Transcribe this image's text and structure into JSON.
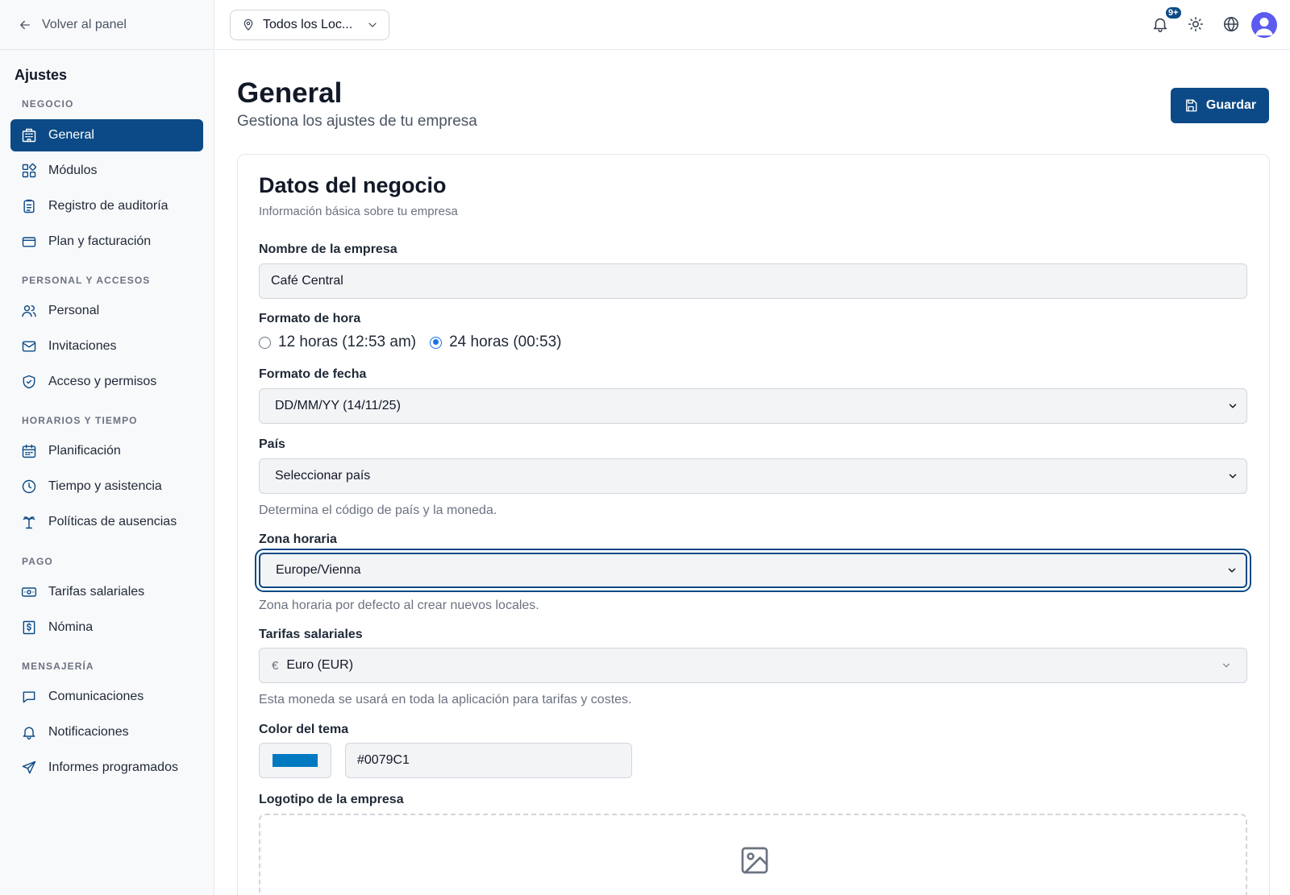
{
  "sidebar": {
    "back_label": "Volver al panel",
    "title": "Ajustes",
    "sections": {
      "negocio": "NEGOCIO",
      "personal": "PERSONAL Y ACCESOS",
      "horarios": "HORARIOS Y TIEMPO",
      "pago": "PAGO",
      "mensajeria": "MENSAJERÍA"
    },
    "items": {
      "general": "General",
      "modulos": "Módulos",
      "auditoria": "Registro de auditoría",
      "plan": "Plan y facturación",
      "personal": "Personal",
      "invitaciones": "Invitaciones",
      "acceso": "Acceso y permisos",
      "planificacion": "Planificación",
      "tiempo": "Tiempo y asistencia",
      "ausencias": "Políticas de ausencias",
      "tarifas": "Tarifas salariales",
      "nomina": "Nómina",
      "comunicaciones": "Comunicaciones",
      "notificaciones": "Notificaciones",
      "informes": "Informes programados"
    },
    "active_item": "general"
  },
  "topbar": {
    "location_label": "Todos los Loc...",
    "notification_badge": "9+",
    "icons": [
      "bell-icon",
      "sun-icon",
      "globe-icon",
      "avatar"
    ]
  },
  "page": {
    "title": "General",
    "subtitle": "Gestiona los ajustes de tu empresa",
    "save_label": "Guardar"
  },
  "card": {
    "title": "Datos del negocio",
    "subtitle": "Información básica sobre tu empresa",
    "company_name": {
      "label": "Nombre de la empresa",
      "value": "Café Central"
    },
    "time_format": {
      "label": "Formato de hora",
      "options": [
        "12 horas (12:53 am)",
        "24 horas (00:53)"
      ],
      "selected": "24 horas (00:53)"
    },
    "date_format": {
      "label": "Formato de fecha",
      "value": "DD/MM/YY (14/11/25)"
    },
    "country": {
      "label": "País",
      "value": "Seleccionar país",
      "helper": "Determina el código de país y la moneda."
    },
    "timezone": {
      "label": "Zona horaria",
      "value": "Europe/Vienna",
      "helper": "Zona horaria por defecto al crear nuevos locales."
    },
    "currency": {
      "label": "Tarifas salariales",
      "symbol": "€",
      "value": "Euro (EUR)",
      "helper": "Esta moneda se usará en toda la aplicación para tarifas y costes."
    },
    "theme_color": {
      "label": "Color del tema",
      "value": "#0079C1"
    },
    "logo": {
      "label": "Logotipo de la empresa"
    }
  },
  "colors": {
    "primary": "#0b4a86",
    "theme": "#0079C1",
    "radio_accent": "#1a73e8"
  }
}
